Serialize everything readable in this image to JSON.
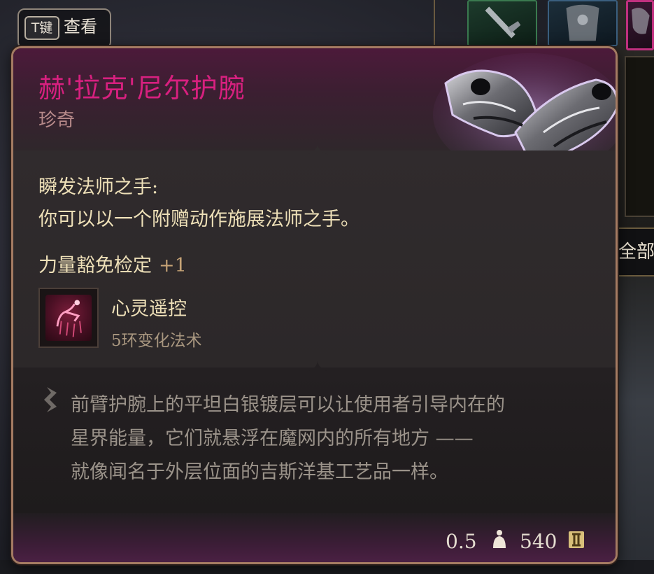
{
  "key_hint": {
    "key": "T键",
    "label": "查看"
  },
  "item": {
    "name": "赫'拉克'尼尔护腕",
    "rarity": "珍奇",
    "name_color": "#d7207f",
    "art_icon": "bracers-icon"
  },
  "ability": {
    "title": "瞬发法师之手:",
    "description": "你可以以一个附赠动作施展法师之手。"
  },
  "bonus": {
    "label": "力量豁免检定",
    "value": "+1"
  },
  "spell": {
    "icon": "telekinesis-spell-icon",
    "name": "心灵遥控",
    "type": "5环变化法术"
  },
  "lore": {
    "icon": "quill-icon",
    "lines": [
      "前臂护腕上的平坦白银镀层可以让使用者引导内在的",
      "星界能量，它们就悬浮在魔网内的所有地方 ——",
      "就像闻名于外层位面的吉斯洋基工艺品一样。"
    ]
  },
  "footer": {
    "weight": "0.5",
    "weight_icon": "weight-icon",
    "price": "540",
    "price_icon": "gold-coin-icon"
  },
  "side": {
    "filter_tab": "全部"
  }
}
